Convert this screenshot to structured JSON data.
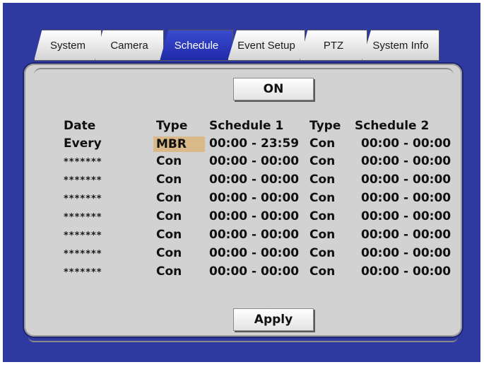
{
  "tabs": [
    {
      "label": "System"
    },
    {
      "label": "Camera"
    },
    {
      "label": "Schedule",
      "active": true
    },
    {
      "label": "Event Setup"
    },
    {
      "label": "PTZ"
    },
    {
      "label": "System Info"
    }
  ],
  "toggle": {
    "label": "ON"
  },
  "headers": {
    "date": "Date",
    "type1": "Type",
    "sched1": "Schedule 1",
    "type2": "Type",
    "sched2": "Schedule 2"
  },
  "rows": [
    {
      "date": "Every",
      "type1": "MBR",
      "sched1": "00:00 - 23:59",
      "type2": "Con",
      "sched2": "00:00 - 00:00"
    },
    {
      "date": "*******",
      "type1": "Con",
      "sched1": "00:00 - 00:00",
      "type2": "Con",
      "sched2": "00:00 - 00:00"
    },
    {
      "date": "*******",
      "type1": "Con",
      "sched1": "00:00 - 00:00",
      "type2": "Con",
      "sched2": "00:00 - 00:00"
    },
    {
      "date": "*******",
      "type1": "Con",
      "sched1": "00:00 - 00:00",
      "type2": "Con",
      "sched2": "00:00 - 00:00"
    },
    {
      "date": "*******",
      "type1": "Con",
      "sched1": "00:00 - 00:00",
      "type2": "Con",
      "sched2": "00:00 - 00:00"
    },
    {
      "date": "*******",
      "type1": "Con",
      "sched1": "00:00 - 00:00",
      "type2": "Con",
      "sched2": "00:00 - 00:00"
    },
    {
      "date": "*******",
      "type1": "Con",
      "sched1": "00:00 - 00:00",
      "type2": "Con",
      "sched2": "00:00 - 00:00"
    },
    {
      "date": "*******",
      "type1": "Con",
      "sched1": "00:00 - 00:00",
      "type2": "Con",
      "sched2": "00:00 - 00:00"
    }
  ],
  "apply": {
    "label": "Apply"
  },
  "colors": {
    "background": "#2f3aa0",
    "panel": "#d2d2d2",
    "active_tab": "#2a36bf",
    "selection": "#d9b98a"
  }
}
